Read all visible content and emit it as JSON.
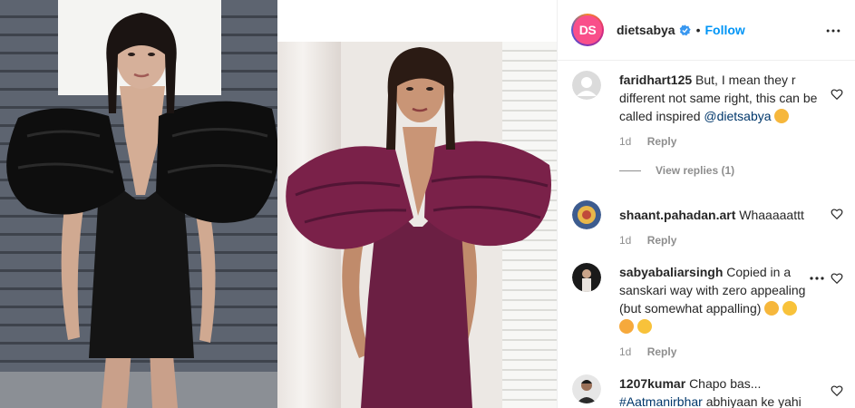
{
  "post": {
    "account": {
      "avatar_initials": "DS",
      "username": "dietsabya",
      "verified": true,
      "separator": "•",
      "follow_label": "Follow"
    },
    "media": {
      "left_image": "woman-in-black-ruffle-dress",
      "right_image": "woman-in-purple-ruffle-dress"
    }
  },
  "comments": [
    {
      "username": "faridhart125",
      "text": "But, I mean they r different not same right, this can be called inspired",
      "mention": "@dietsabya",
      "emoji": "hugging-face",
      "time": "1d",
      "reply_label": "Reply",
      "view_replies": "View replies (1)",
      "avatar": "default-avatar"
    },
    {
      "username": "shaant.pahadan.art",
      "text": "Whaaaaattt",
      "time": "1d",
      "reply_label": "Reply",
      "avatar": "painting-avatar"
    },
    {
      "username": "sabyabaliarsingh",
      "text": "Copied in a sanskari way with zero appealing (but somewhat appalling)",
      "emojis": [
        "sad-face",
        "grinning-face",
        "tongue-face",
        "grinning-face"
      ],
      "time": "1d",
      "reply_label": "Reply",
      "avatar": "person-avatar"
    },
    {
      "username": "1207kumar",
      "text_line1": "Chapo bas...",
      "hashtag": "#Aatmanirbhar",
      "text_line2": "abhiyaan ke yahi",
      "avatar": "man-avatar"
    }
  ],
  "colors": {
    "accent": "#0095f6",
    "text": "#262626",
    "muted": "#8e8e8e",
    "mention": "#00376b",
    "brand_avatar": "#f94f8a"
  }
}
